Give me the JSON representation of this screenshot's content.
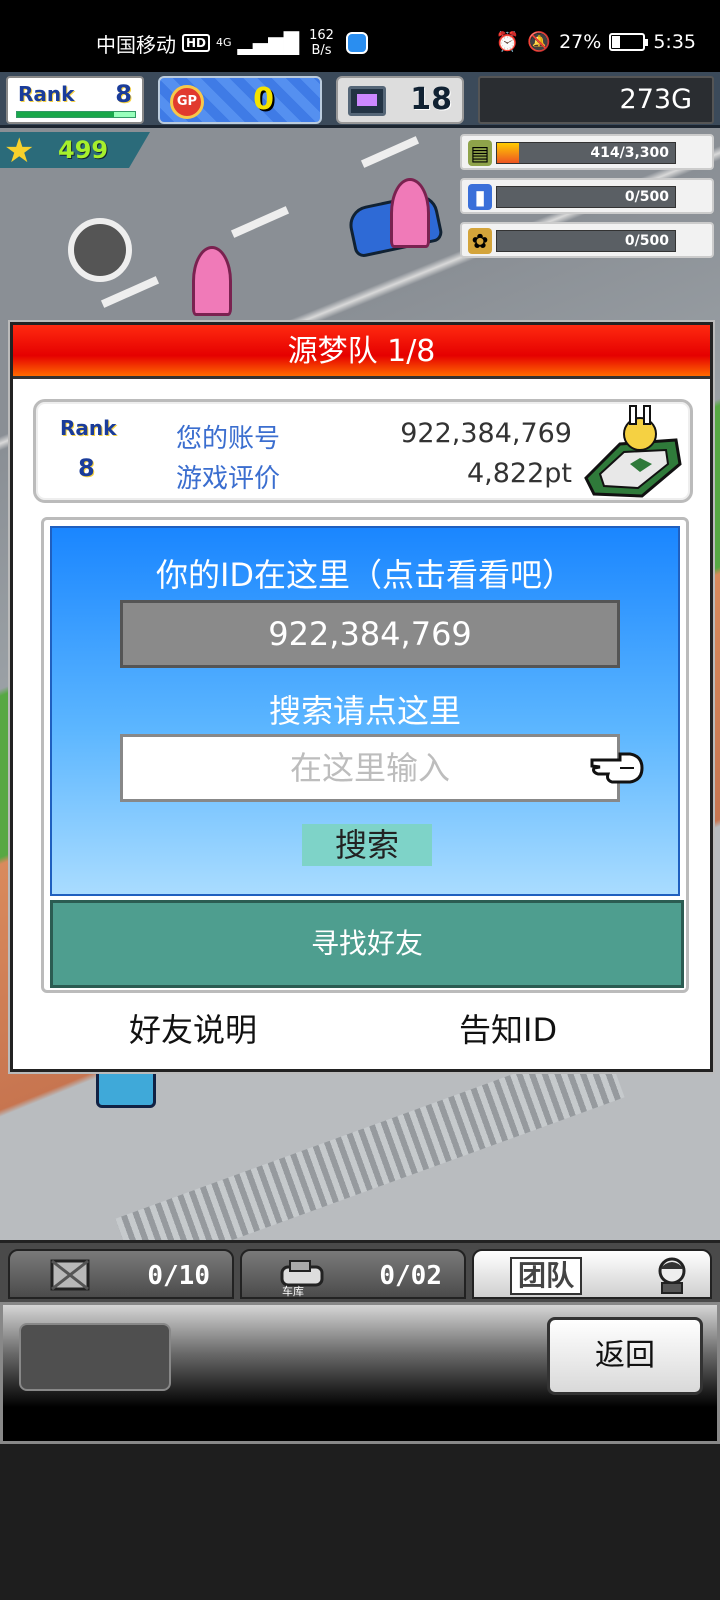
{
  "status_bar": {
    "carrier": "中国移动",
    "hd": "HD",
    "network": "4G",
    "speed_value": "162",
    "speed_unit": "B/s",
    "battery": "27%",
    "battery_level": 0.27,
    "time": "5:35"
  },
  "top_bar": {
    "rank_label": "Rank",
    "rank_value": "8",
    "gp_icon_text": "GP",
    "gp_value": "0",
    "pc_value": "18",
    "money": "273G"
  },
  "hud": {
    "stars": "499",
    "resources": [
      {
        "icon": "coin-stack-icon",
        "text": "414/3,300",
        "level": 0.125,
        "icon_color": "#8fa34a"
      },
      {
        "icon": "fuel-bottle-icon",
        "text": "0/500",
        "level": 0,
        "icon_color": "#3a6fd9"
      },
      {
        "icon": "wheat-icon",
        "text": "0/500",
        "level": 0,
        "icon_color": "#d4a43a"
      }
    ]
  },
  "modal": {
    "title": "源梦队 1/8",
    "rank_label": "Rank",
    "rank_value": "8",
    "account_label": "您的账号",
    "account_value": "922,384,769",
    "rating_label": "游戏评价",
    "rating_value": "4,822pt",
    "id_heading": "你的ID在这里（点击看看吧）",
    "id_value": "922,384,769",
    "search_heading": "搜索请点这里",
    "search_placeholder": "在这里输入",
    "search_button": "搜索",
    "find_friends_button": "寻找好友",
    "friend_help_link": "好友说明",
    "share_id_link": "告知ID"
  },
  "tabs": {
    "items_count": "0/10",
    "garage_label": "车库",
    "garage_count": "0/02",
    "team_label": "团队"
  },
  "bottom": {
    "back_button": "返回"
  },
  "colors": {
    "modal_title_red": "#e50000",
    "panel_blue": "#1a86ff",
    "find_button_teal": "#4e9e8f",
    "search_button_mint": "#7ed3c8"
  }
}
